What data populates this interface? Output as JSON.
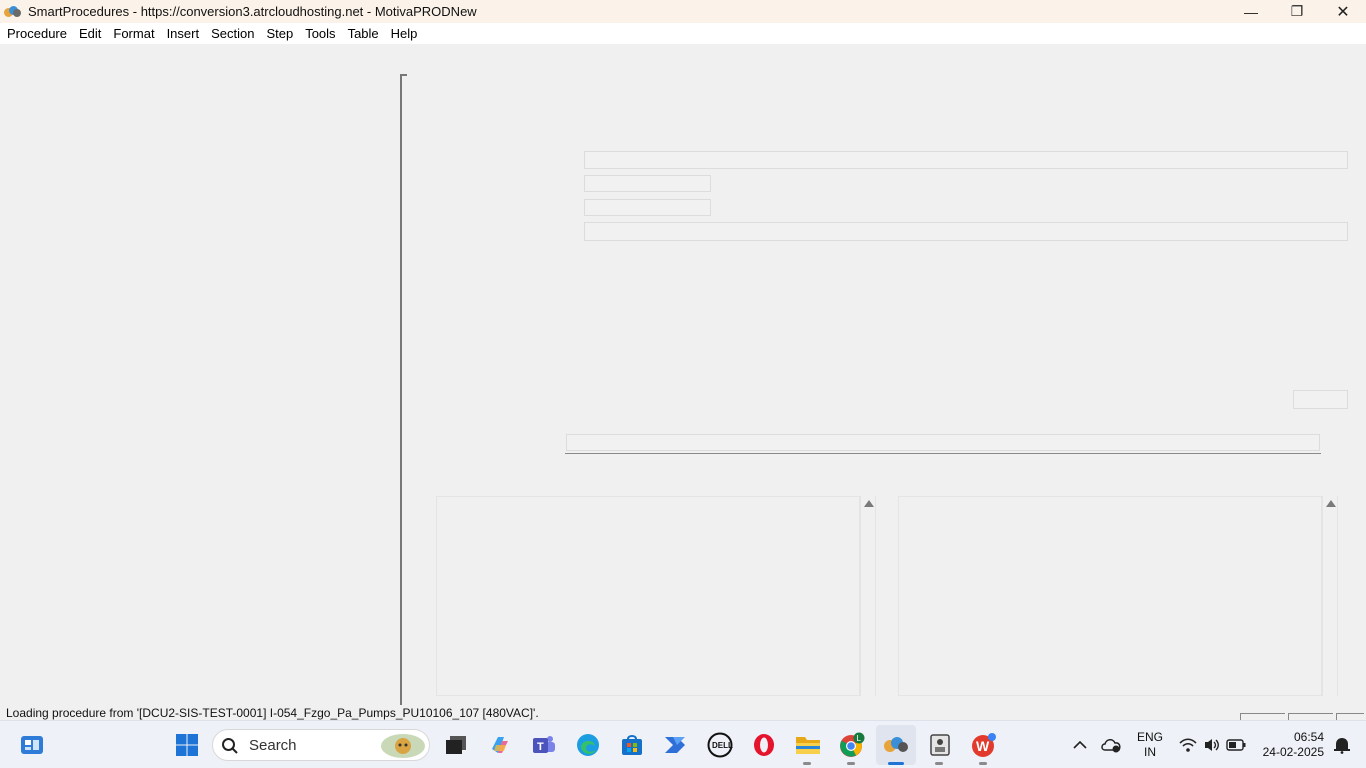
{
  "window": {
    "title": "SmartProcedures - https://conversion3.atrcloudhosting.net - MotivaPRODNew",
    "minimize": "—",
    "maximize": "❐",
    "close": "✕"
  },
  "menu": [
    "Procedure",
    "Edit",
    "Format",
    "Insert",
    "Section",
    "Step",
    "Tools",
    "Table",
    "Help"
  ],
  "status": {
    "text": "Loading procedure from '[DCU2-SIS-TEST-0001] I-054_Fzgo_Pa_Pumps_PU10106_107 [480VAC]'."
  },
  "taskbar": {
    "search_placeholder": "Search",
    "tray": {
      "language": "ENG",
      "region": "IN",
      "time": "06:54",
      "date": "24-02-2025"
    },
    "chrome_badge": "L",
    "colors": {
      "windows_blue": "#1e74d6",
      "opera_red": "#e5132b",
      "wps_red": "#e23b2e"
    }
  }
}
